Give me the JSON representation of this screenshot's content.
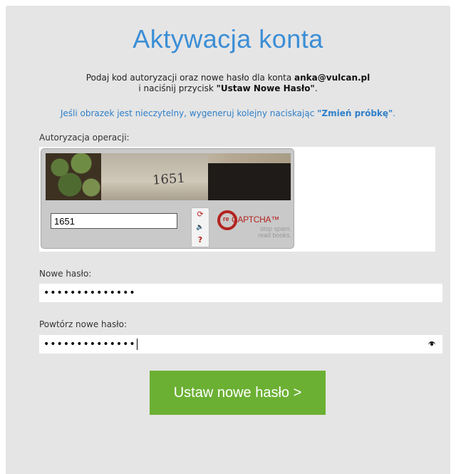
{
  "title": "Aktywacja konta",
  "instructions": {
    "line1_prefix": "Podaj kod autoryzacji oraz nowe hasło dla konta ",
    "email": "anka@vulcan.pl",
    "line2_prefix": "i naciśnij przycisk ",
    "button_ref": "\"Ustaw Nowe Hasło\"",
    "line2_suffix": "."
  },
  "hint": {
    "prefix": "Jeśli obrazek jest nieczytelny, wygeneruj kolejny naciskając ",
    "link": "\"Zmień próbkę\"",
    "suffix": "."
  },
  "captcha": {
    "label": "Autoryzacja operacji:",
    "image_text": "1651",
    "input_value": "1651",
    "buttons": [
      "⟳",
      "🔈",
      "?"
    ],
    "logo": {
      "re": "re",
      "name": "CAPTCHA™",
      "tagline1": "stop spam.",
      "tagline2": "read books."
    }
  },
  "new_password": {
    "label": "Nowe hasło:",
    "value": "••••••••••••••"
  },
  "repeat_password": {
    "label": "Powtórz nowe hasło:",
    "value": "••••••••••••••"
  },
  "submit_label": "Ustaw nowe hasło >",
  "colors": {
    "accent_blue": "#3b8ed6",
    "button_green": "#6bb033",
    "recaptcha_red": "#b3231f"
  }
}
